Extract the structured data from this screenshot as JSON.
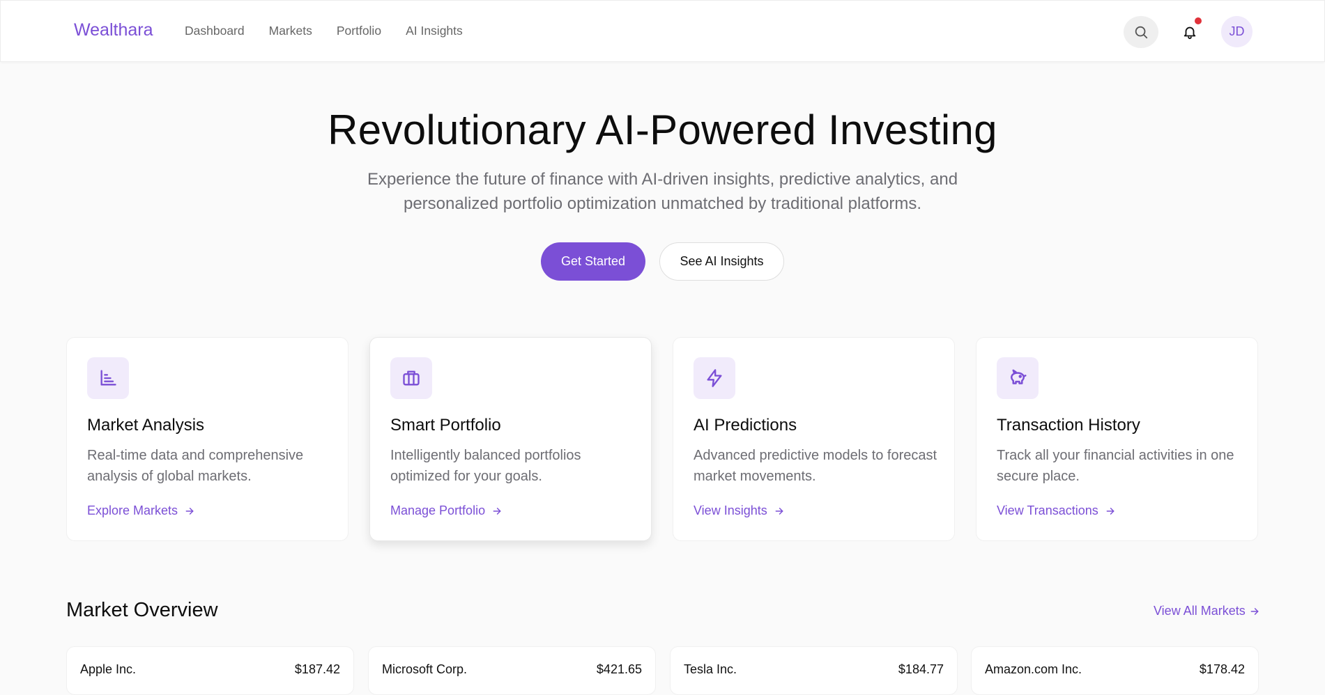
{
  "header": {
    "brand": "Wealthara",
    "nav": [
      "Dashboard",
      "Markets",
      "Portfolio",
      "AI Insights"
    ],
    "search_icon": "search-icon",
    "bell_icon": "bell-icon",
    "has_notification": true,
    "avatar_initials": "JD"
  },
  "hero": {
    "title": "Revolutionary AI-Powered Investing",
    "subtitle": "Experience the future of finance with AI-driven insights, predictive analytics, and personalized portfolio optimization unmatched by traditional platforms.",
    "primary_button": "Get Started",
    "secondary_button": "See AI Insights"
  },
  "features": [
    {
      "icon": "bar-chart-icon",
      "title": "Market Analysis",
      "description": "Real-time data and comprehensive analysis of global markets.",
      "link": "Explore Markets"
    },
    {
      "icon": "briefcase-icon",
      "title": "Smart Portfolio",
      "description": "Intelligently balanced portfolios optimized for your goals.",
      "link": "Manage Portfolio"
    },
    {
      "icon": "lightning-icon",
      "title": "AI Predictions",
      "description": "Advanced predictive models to forecast market movements.",
      "link": "View Insights"
    },
    {
      "icon": "piggy-bank-icon",
      "title": "Transaction History",
      "description": "Track all your financial activities in one secure place.",
      "link": "View Transactions"
    }
  ],
  "market_overview": {
    "title": "Market Overview",
    "view_all": "View All Markets",
    "tickers": [
      {
        "name": "Apple Inc.",
        "price": "$187.42"
      },
      {
        "name": "Microsoft Corp.",
        "price": "$421.65"
      },
      {
        "name": "Tesla Inc.",
        "price": "$184.77"
      },
      {
        "name": "Amazon.com Inc.",
        "price": "$178.42"
      }
    ]
  },
  "colors": {
    "accent": "#7b4fd6",
    "accent_light": "#f1ebfb",
    "notification": "#e0323a",
    "background": "#fafafa"
  }
}
